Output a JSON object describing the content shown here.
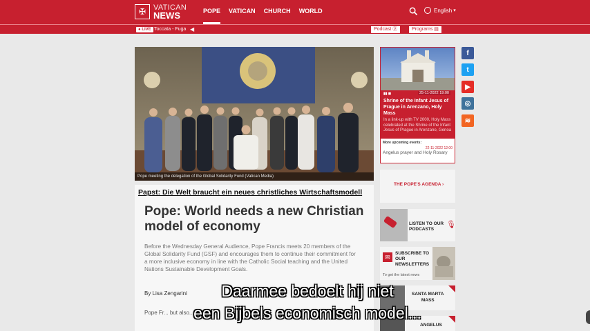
{
  "header": {
    "logo_line1": "VATICAN",
    "logo_line2": "NEWS",
    "nav": [
      "POPE",
      "VATICAN",
      "CHURCH",
      "WORLD"
    ],
    "language": "English"
  },
  "subbar": {
    "live_label": "LIVE",
    "live_title": "Toccata - Fuga",
    "podcast_label": "Podcast",
    "programs_label": "Programs"
  },
  "hero": {
    "caption": "Pope meeting the delegation of the Global Solidarity Fund  (Vatican Media)"
  },
  "article": {
    "german_link": "Papst: Die Welt braucht ein neues christliches Wirtschaftsmodell",
    "headline": "Pope: World needs a new Christian model of economy",
    "summary": "Before the Wednesday General Audience, Pope Francis meets 20 members of the Global Solidarity Fund (GSF) and encourages them to continue their commitment for a more inclusive economy in line with the Catholic Social teaching and the United Nations Sustainable Development Goals.",
    "byline": "By Lisa Zengarini",
    "body_start": "Pope Fr... but also... his time."
  },
  "subtitles": {
    "line1": "Daarmee bedoelt hij niet",
    "line2": "een Bijbels economisch model..."
  },
  "live_card": {
    "date": "25-11-2022 19:00",
    "title": "Shrine of the Infant Jesus of Prague in Arenzano, Holy Mass",
    "description": "In a link-up with TV 2000, Holy Mass celebrated at the Shrine of the Infant Jesus of Prague in Arenzano, Genoa",
    "more_label": "More upcoming events:",
    "more_date": "22-11-2022 12:00",
    "more_title": "Angelus prayer and Holy Rosary"
  },
  "cards": {
    "agenda": "THE POPE'S AGENDA",
    "podcasts_line1": "LISTEN TO OUR",
    "podcasts_line2": "PODCASTS",
    "newsletter_line1": "SUBSCRIBE TO",
    "newsletter_line2": "OUR",
    "newsletter_line3": "NEWSLETTERS",
    "newsletter_sub": "To get the latest news",
    "santa_marta_line1": "SANTA MARTA",
    "santa_marta_line2": "MASS",
    "angelus": "ANGELUS"
  },
  "social": [
    "facebook-icon",
    "twitter-icon",
    "youtube-icon",
    "instagram-icon",
    "rss-icon"
  ],
  "colors": {
    "brand": "#c7202f",
    "background": "#e9e9e9"
  }
}
